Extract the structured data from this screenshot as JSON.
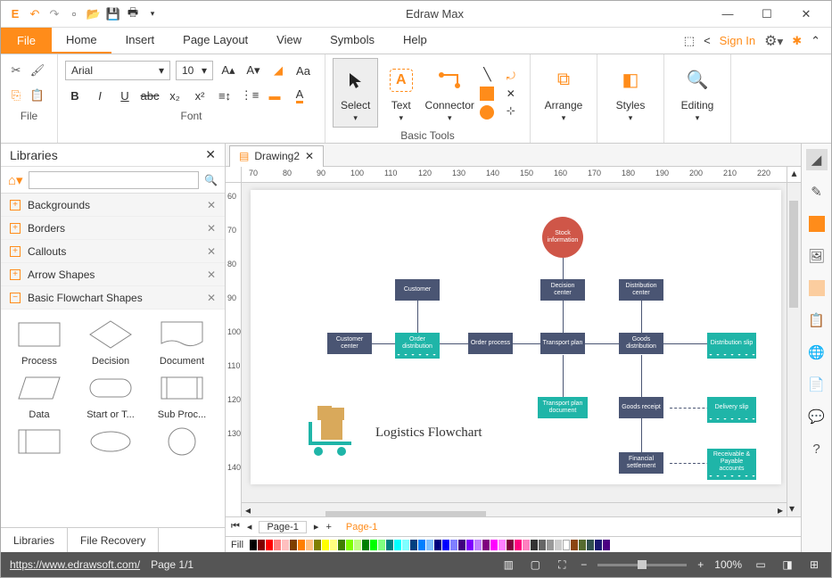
{
  "app": {
    "title": "Edraw Max"
  },
  "menubar": {
    "file": "File",
    "tabs": [
      "Home",
      "Insert",
      "Page Layout",
      "View",
      "Symbols",
      "Help"
    ],
    "signin": "Sign In"
  },
  "ribbon": {
    "font_name": "Arial",
    "font_size": "10",
    "group_file": "File",
    "group_font": "Font",
    "group_basic_tools": "Basic Tools",
    "select": "Select",
    "text": "Text",
    "connector": "Connector",
    "arrange": "Arrange",
    "styles": "Styles",
    "editing": "Editing"
  },
  "libraries": {
    "title": "Libraries",
    "search_placeholder": "",
    "cats": [
      "Backgrounds",
      "Borders",
      "Callouts",
      "Arrow Shapes",
      "Basic Flowchart Shapes"
    ],
    "shapes": [
      "Process",
      "Decision",
      "Document",
      "Data",
      "Start or T...",
      "Sub Proc..."
    ],
    "foot": [
      "Libraries",
      "File Recovery"
    ]
  },
  "doc": {
    "tab": "Drawing2"
  },
  "ruler_h": [
    "70",
    "80",
    "90",
    "100",
    "110",
    "120",
    "130",
    "140",
    "150",
    "160",
    "170",
    "180",
    "190",
    "200",
    "210",
    "220"
  ],
  "ruler_v": [
    "60",
    "70",
    "80",
    "90",
    "100",
    "110",
    "120",
    "130",
    "140"
  ],
  "flowchart": {
    "title": "Logistics Flowchart",
    "nodes": {
      "stock": "Stock information",
      "customer": "Customer",
      "dec_center": "Decision center",
      "dist_center": "Distribution center",
      "cust_center": "Customer center",
      "order_dist": "Order distribution",
      "order_proc": "Order process",
      "trans_plan": "Transport plan",
      "goods_dist": "Goods distribution",
      "dist_slip": "Distribution slip",
      "trans_doc": "Transport plan document",
      "goods_receipt": "Goods receipt",
      "delivery_slip": "Delivery slip",
      "fin_settle": "Financial settlement",
      "recv_pay": "Receivable & Payable accounts"
    }
  },
  "pagetabs": {
    "page1": "Page-1",
    "active": "Page-1"
  },
  "colorbar_label": "Fill",
  "status": {
    "url": "https://www.edrawsoft.com/",
    "page": "Page 1/1",
    "zoom": "100%"
  }
}
